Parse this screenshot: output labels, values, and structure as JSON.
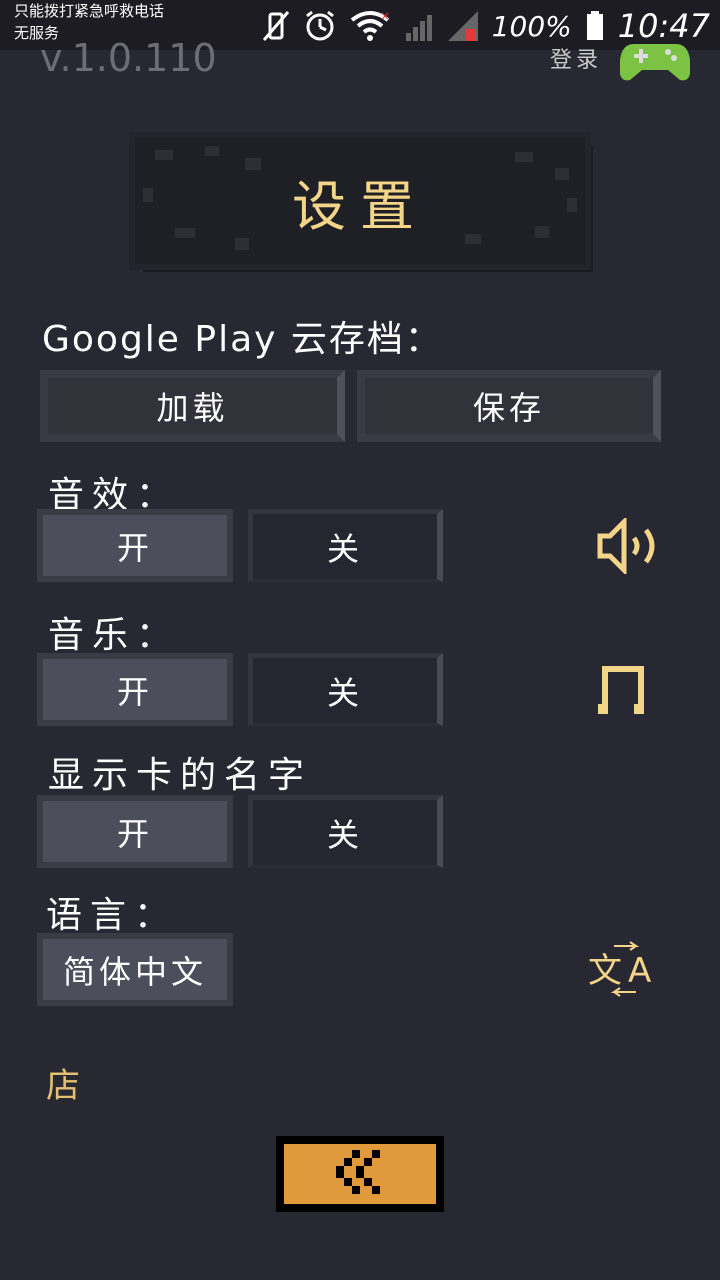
{
  "status_bar": {
    "line1": "只能拨打紧急呼救电话",
    "line2": "无服务",
    "battery": "100%",
    "time": "10:47"
  },
  "header": {
    "version": "v.1.0.110",
    "login": "登录"
  },
  "title": "设置",
  "cloud_save": {
    "label": "Google Play 云存档：",
    "load": "加载",
    "save": "保存"
  },
  "sound": {
    "label": "音效：",
    "on": "开",
    "off": "关",
    "selected": "on",
    "icon": "speaker-icon"
  },
  "music": {
    "label": "音乐：",
    "on": "开",
    "off": "关",
    "selected": "on",
    "icon": "music-note-icon"
  },
  "card_names": {
    "label": "显示卡的名字",
    "on": "开",
    "off": "关",
    "selected": "on"
  },
  "language": {
    "label": "语言：",
    "value": "简体中文",
    "icon": "translate-icon"
  },
  "shop": "店",
  "colors": {
    "background": "#282833",
    "accent_gold": "#f3d58a",
    "back_button": "#e09a3c",
    "gamepad_green": "#7cc243"
  }
}
